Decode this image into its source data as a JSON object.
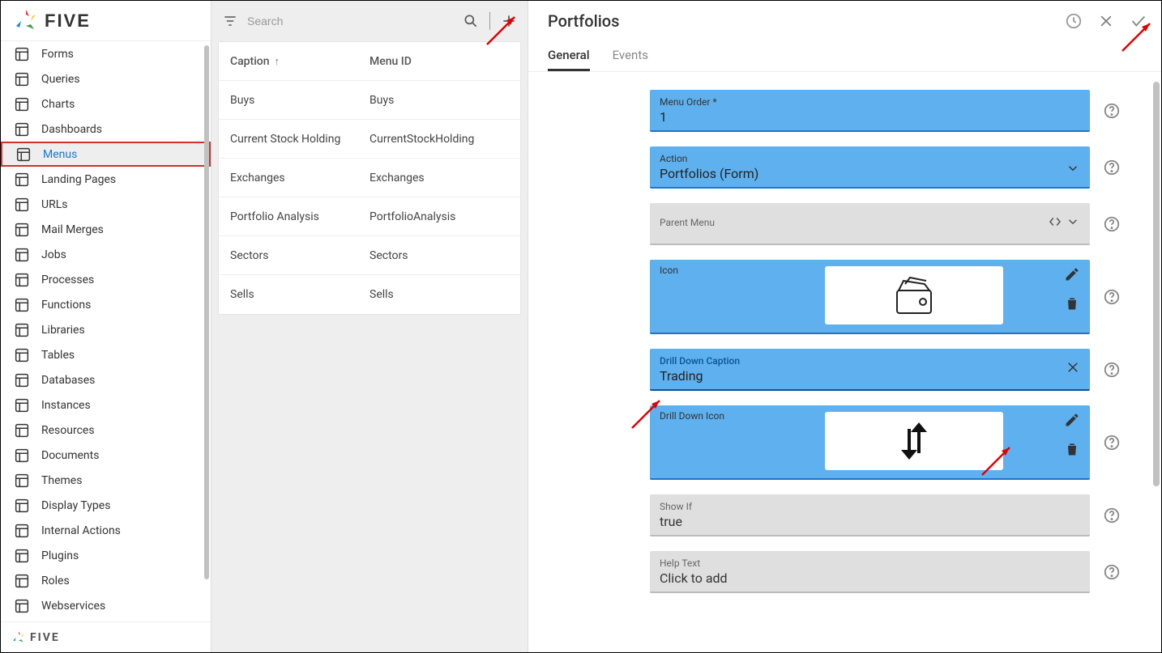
{
  "brand": "FIVE",
  "sidebar": {
    "items": [
      {
        "label": "Forms"
      },
      {
        "label": "Queries"
      },
      {
        "label": "Charts"
      },
      {
        "label": "Dashboards"
      },
      {
        "label": "Menus"
      },
      {
        "label": "Landing Pages"
      },
      {
        "label": "URLs"
      },
      {
        "label": "Mail Merges"
      },
      {
        "label": "Jobs"
      },
      {
        "label": "Processes"
      },
      {
        "label": "Functions"
      },
      {
        "label": "Libraries"
      },
      {
        "label": "Tables"
      },
      {
        "label": "Databases"
      },
      {
        "label": "Instances"
      },
      {
        "label": "Resources"
      },
      {
        "label": "Documents"
      },
      {
        "label": "Themes"
      },
      {
        "label": "Display Types"
      },
      {
        "label": "Internal Actions"
      },
      {
        "label": "Plugins"
      },
      {
        "label": "Roles"
      },
      {
        "label": "Webservices"
      }
    ],
    "active_index": 4
  },
  "search": {
    "placeholder": "Search"
  },
  "list": {
    "headers": {
      "caption": "Caption",
      "menu_id": "Menu ID"
    },
    "rows": [
      {
        "caption": "Buys",
        "menu_id": "Buys"
      },
      {
        "caption": "Current Stock Holding",
        "menu_id": "CurrentStockHolding"
      },
      {
        "caption": "Exchanges",
        "menu_id": "Exchanges"
      },
      {
        "caption": "Portfolio Analysis",
        "menu_id": "PortfolioAnalysis"
      },
      {
        "caption": "Sectors",
        "menu_id": "Sectors"
      },
      {
        "caption": "Sells",
        "menu_id": "Sells"
      }
    ]
  },
  "detail": {
    "title": "Portfolios",
    "tabs": [
      {
        "label": "General",
        "active": true
      },
      {
        "label": "Events",
        "active": false
      }
    ],
    "fields": {
      "menu_order": {
        "label": "Menu Order *",
        "value": "1"
      },
      "action": {
        "label": "Action",
        "value": "Portfolios (Form)"
      },
      "parent_menu": {
        "label": "Parent Menu",
        "value": ""
      },
      "icon": {
        "label": "Icon"
      },
      "drill_caption": {
        "label": "Drill Down Caption",
        "value": "Trading"
      },
      "drill_icon": {
        "label": "Drill Down Icon"
      },
      "show_if": {
        "label": "Show If",
        "value": "true"
      },
      "help_text": {
        "label": "Help Text",
        "value": "Click to add"
      }
    }
  }
}
